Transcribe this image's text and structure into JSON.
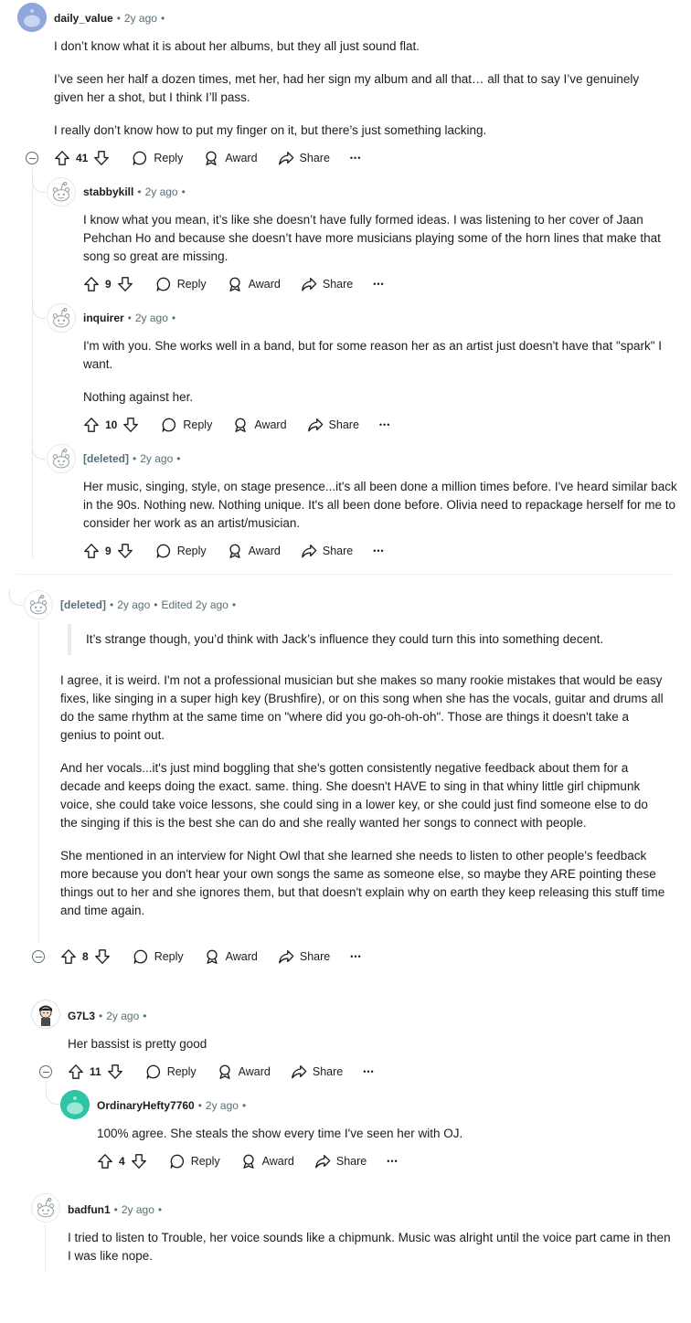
{
  "comments": {
    "c1": {
      "username": "daily_value",
      "time": "2y ago",
      "paragraphs": [
        "I don’t know what it is about her albums, but they all just sound flat.",
        "I’ve seen her half a dozen times, met her, had her sign my album and all that… all that to say I’ve genuinely given her a shot, but I think I’ll pass.",
        "I really don’t know how to put my finger on it, but there’s just something lacking."
      ],
      "votes": "41"
    },
    "c2": {
      "username": "stabbykill",
      "time": "2y ago",
      "paragraphs": [
        "I know what you mean, it’s like she doesn’t have fully formed ideas. I was listening to her cover of Jaan Pehchan Ho and because she doesn’t have more musicians playing some of the horn lines that make that song so great are missing."
      ],
      "votes": "9"
    },
    "c3": {
      "username": "inquirer",
      "time": "2y ago",
      "paragraphs": [
        "I'm with you. She works well in a band, but for some reason her as an artist just doesn't have that \"spark\" I want.",
        "Nothing against her."
      ],
      "votes": "10"
    },
    "c4": {
      "username": "[deleted]",
      "time": "2y ago",
      "paragraphs": [
        "Her music, singing, style, on stage presence...it's all been done a million times before. I've heard similar back in the 90s. Nothing new. Nothing unique. It's all been done before. Olivia need to repackage herself for me to consider her work as an artist/musician."
      ],
      "votes": "9"
    },
    "c5": {
      "username": "[deleted]",
      "time": "2y ago",
      "edited": "Edited 2y ago",
      "quote": "It’s strange though, you’d think with Jack’s influence they could turn this into something decent.",
      "paragraphs": [
        "I agree, it is weird. I'm not a professional musician but she makes so many rookie mistakes that would be easy fixes, like singing in a super high key (Brushfire), or on this song when she has the vocals, guitar and drums all do the same rhythm at the same time on \"where did you go-oh-oh-oh\". Those are things it doesn't take a genius to point out.",
        "And her vocals...it's just mind boggling that she's gotten consistently negative feedback about them for a decade and keeps doing the exact. same. thing. She doesn't HAVE to sing in that whiny little girl chipmunk voice, she could take voice lessons, she could sing in a lower key, or she could just find someone else to do the singing if this is the best she can do and she really wanted her songs to connect with people.",
        "She mentioned in an interview for Night Owl that she learned she needs to listen to other people's feedback more because you don't hear your own songs the same as someone else, so maybe they ARE pointing these things out to her and she ignores them, but that doesn't explain why on earth they keep releasing this stuff time and time again."
      ],
      "votes": "8"
    },
    "c6": {
      "username": "G7L3",
      "time": "2y ago",
      "paragraphs": [
        "Her bassist is pretty good"
      ],
      "votes": "11"
    },
    "c7": {
      "username": "OrdinaryHefty7760",
      "time": "2y ago",
      "paragraphs": [
        "100% agree. She steals the show every time I've seen her with OJ."
      ],
      "votes": "4"
    },
    "c8": {
      "username": "badfun1",
      "time": "2y ago",
      "paragraphs": [
        "I tried to listen to Trouble, her voice sounds like a chipmunk. Music was alright until the voice part came in then I was like nope."
      ]
    }
  },
  "actions": {
    "reply": "Reply",
    "award": "Award",
    "share": "Share",
    "more": "•••",
    "dot": "•"
  },
  "colors": {
    "meta": "#576f76",
    "thread_line": "#e5ebee",
    "avatar_blue": "#8fa7dc",
    "avatar_teal": "#2ec4a6"
  },
  "icons": [
    "upvote-icon",
    "downvote-icon",
    "reply-bubble-icon",
    "award-icon",
    "share-icon",
    "more-icon",
    "collapse-icon",
    "snoo-avatar-icon"
  ]
}
